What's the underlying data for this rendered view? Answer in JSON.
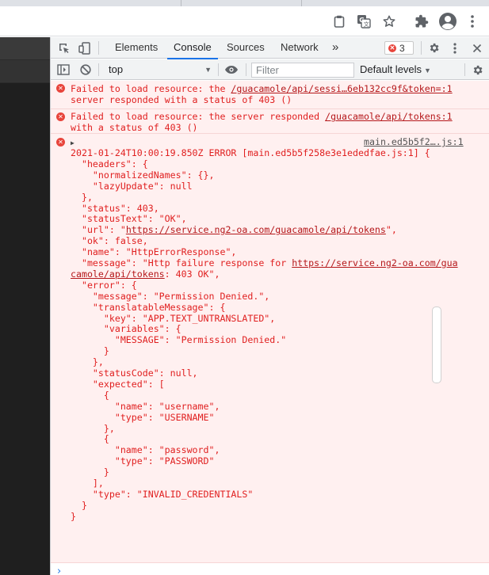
{
  "devtools": {
    "tabs": [
      "Elements",
      "Console",
      "Sources",
      "Network"
    ],
    "more_tabs": "»",
    "error_count": "3",
    "context": "top",
    "filter_placeholder": "Filter",
    "levels": "Default levels"
  },
  "console": {
    "msg1": {
      "line1_prefix": "Failed to load resource: the ",
      "line1_link": "/guacamole/api/sessi…6eb132cc9f&token=:1",
      "line2": "server responded with a status of 403 ()"
    },
    "msg2": {
      "line1_prefix": "Failed to load resource: the server responded ",
      "line1_link": "/guacamole/api/tokens:1",
      "line2": "with a status of 403 ()"
    },
    "msg3": {
      "source": "main.ed5b5f2….js:1",
      "lines": [
        "2021-01-24T10:00:19.850Z ERROR [main.ed5b5f258e3e1ededfae.js:1] {",
        "  \"headers\": {",
        "    \"normalizedNames\": {},",
        "    \"lazyUpdate\": null",
        "  },",
        "  \"status\": 403,",
        "  \"statusText\": \"OK\",",
        "  \"url\": \"",
        "  \"ok\": false,",
        "  \"name\": \"HttpErrorResponse\",",
        "  \"message\": \"Http failure response for ",
        "",
        "  \"error\": {",
        "    \"message\": \"Permission Denied.\",",
        "    \"translatableMessage\": {",
        "      \"key\": \"APP.TEXT_UNTRANSLATED\",",
        "      \"variables\": {",
        "        \"MESSAGE\": \"Permission Denied.\"",
        "      }",
        "    },",
        "    \"statusCode\": null,",
        "    \"expected\": [",
        "      {",
        "        \"name\": \"username\",",
        "        \"type\": \"USERNAME\"",
        "      },",
        "      {",
        "        \"name\": \"password\",",
        "        \"type\": \"PASSWORD\"",
        "      }",
        "    ],",
        "    \"type\": \"INVALID_CREDENTIALS\"",
        "  }",
        "}"
      ],
      "url_link": "https://service.ng2-oa.com/guacamole/api/tokens",
      "url_suffix": "\",",
      "msg_link_a": "https://service.ng2-oa.com/gua",
      "msg_link_b": "camole/api/tokens",
      "msg_suffix": ": 403 OK\","
    },
    "prompt": "›"
  }
}
